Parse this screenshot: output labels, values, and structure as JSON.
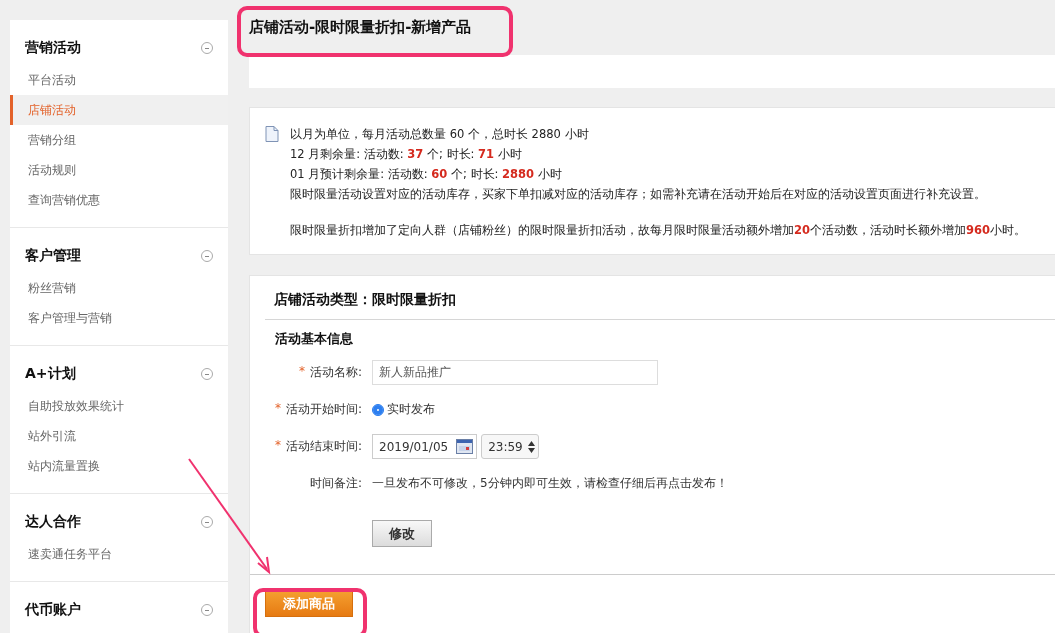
{
  "sidebar": {
    "sections": [
      {
        "title": "营销活动",
        "items": [
          {
            "label": "平台活动",
            "selected": false
          },
          {
            "label": "店铺活动",
            "selected": true
          },
          {
            "label": "营销分组",
            "selected": false
          },
          {
            "label": "活动规则",
            "selected": false
          },
          {
            "label": "查询营销优惠",
            "selected": false
          }
        ]
      },
      {
        "title": "客户管理",
        "items": [
          {
            "label": "粉丝营销",
            "selected": false
          },
          {
            "label": "客户管理与营销",
            "selected": false
          }
        ]
      },
      {
        "title": "A+计划",
        "items": [
          {
            "label": "自助投放效果统计",
            "selected": false
          },
          {
            "label": "站外引流",
            "selected": false
          },
          {
            "label": "站内流量置换",
            "selected": false
          }
        ]
      },
      {
        "title": "达人合作",
        "items": [
          {
            "label": "速卖通任务平台",
            "selected": false
          }
        ]
      },
      {
        "title": "代币账户"
      }
    ]
  },
  "page_title": "店铺活动-限时限量折扣-新增产品",
  "notice": {
    "paragraphs": [
      [
        "以月为单位，每月活动总数量 60 个，总时长 2880 小时",
        "12 月剩余量: 活动数: **37** 个; 时长: **71** 小时",
        "01 月预计剩余量: 活动数: **60** 个; 时长: **2880** 小时",
        "限时限量活动设置对应的活动库存，买家下单扣减对应的活动库存；如需补充请在活动开始后在对应的活动设置页面进行补充设置。"
      ],
      [
        "限时限量折扣增加了定向人群（店铺粉丝）的限时限量折扣活动，故每月限时限量活动额外增加**20**个活动数，活动时长额外增加**960**小时。"
      ]
    ]
  },
  "form": {
    "type_title": "店铺活动类型：限时限量折扣",
    "section_title": "活动基本信息",
    "fields": [
      {
        "kind": "text",
        "label": "活动名称:",
        "required_mark": "*",
        "value": "新人新品推广"
      },
      {
        "kind": "radio",
        "label": "活动开始时间:",
        "required_mark": "*",
        "option": "实时发布",
        "selected": true
      },
      {
        "kind": "datetime",
        "label": "活动结束时间:",
        "required_mark": "*",
        "date": "2019/01/05",
        "time": "23:59"
      },
      {
        "kind": "note",
        "label": "时间备注:",
        "text": "一旦发布不可修改，5分钟内即可生效，请检查仔细后再点击发布！"
      }
    ],
    "edit_button": "修改",
    "add_button": "添加商品"
  }
}
